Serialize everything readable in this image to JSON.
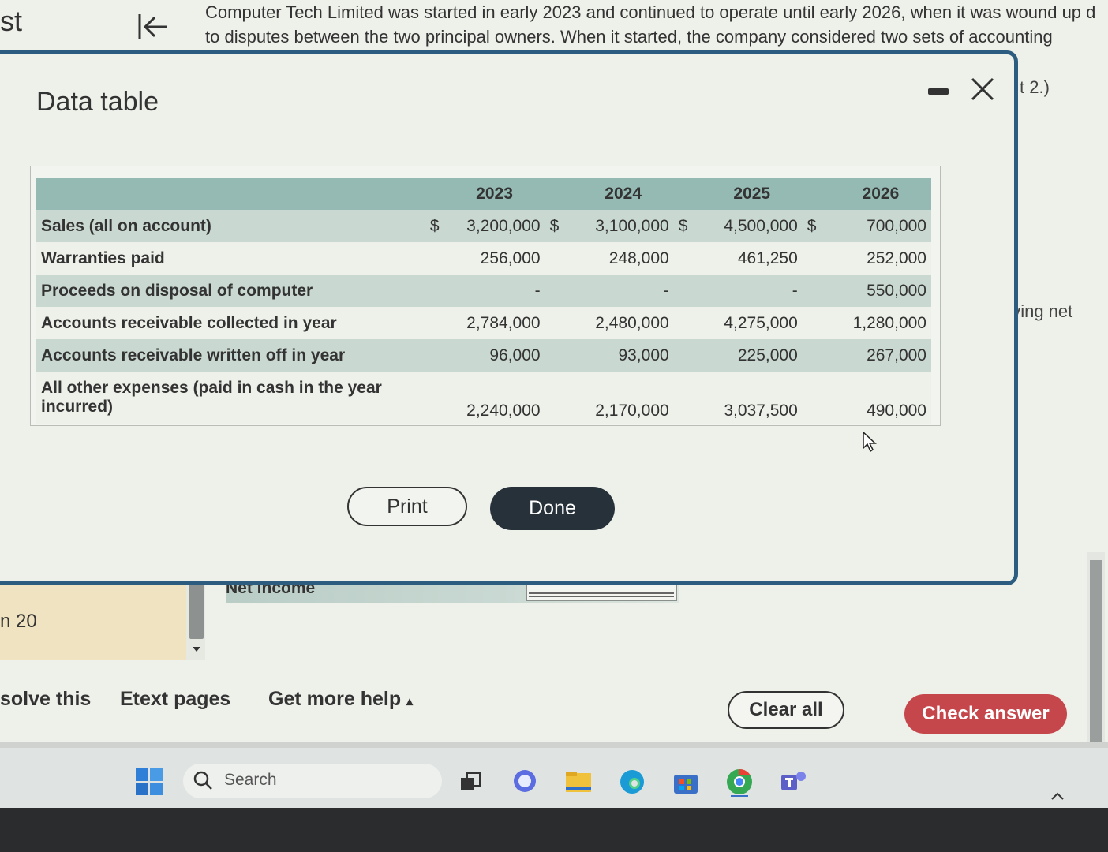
{
  "page": {
    "top_left_fragment": "st",
    "problem_text_line1": "Computer Tech Limited was started in early 2023 and continued to operate until early 2026, when it was wound up d",
    "problem_text_line2": "to disputes between the two principal owners. When it started, the company considered two sets of accounting",
    "right_fragment_1": "t 2.)",
    "right_fragment_2": "riving net",
    "panel_number": "n 20",
    "net_income_label": "Net income"
  },
  "modal": {
    "title": "Data table",
    "table": {
      "headers": [
        "",
        "2023",
        "2024",
        "2025",
        "2026"
      ],
      "rows": [
        {
          "label": "Sales (all on account)",
          "values": [
            "3,200,000",
            "3,100,000",
            "4,500,000",
            "700,000"
          ],
          "currency": "$"
        },
        {
          "label": "Warranties paid",
          "values": [
            "256,000",
            "248,000",
            "461,250",
            "252,000"
          ]
        },
        {
          "label": "Proceeds on disposal of computer",
          "values": [
            "-",
            "-",
            "-",
            "550,000"
          ]
        },
        {
          "label": "Accounts receivable collected in year",
          "values": [
            "2,784,000",
            "2,480,000",
            "4,275,000",
            "1,280,000"
          ]
        },
        {
          "label": "Accounts receivable written off in year",
          "values": [
            "96,000",
            "93,000",
            "225,000",
            "267,000"
          ]
        },
        {
          "label": "All other expenses (paid in cash in the year incurred)",
          "values": [
            "2,240,000",
            "2,170,000",
            "3,037,500",
            "490,000"
          ]
        }
      ]
    },
    "print_label": "Print",
    "done_label": "Done"
  },
  "footer": {
    "solve_this_fragment": "solve this",
    "etext_label": "Etext pages",
    "help_label": "Get more help",
    "help_arrow": "▴",
    "clear_label": "Clear all",
    "check_label": "Check answer"
  },
  "taskbar": {
    "search_placeholder": "Search"
  },
  "colors": {
    "modal_border": "#2c5c80",
    "table_header": "#94bab3",
    "check_answer": "#c6474b",
    "done_button": "#27313a"
  }
}
